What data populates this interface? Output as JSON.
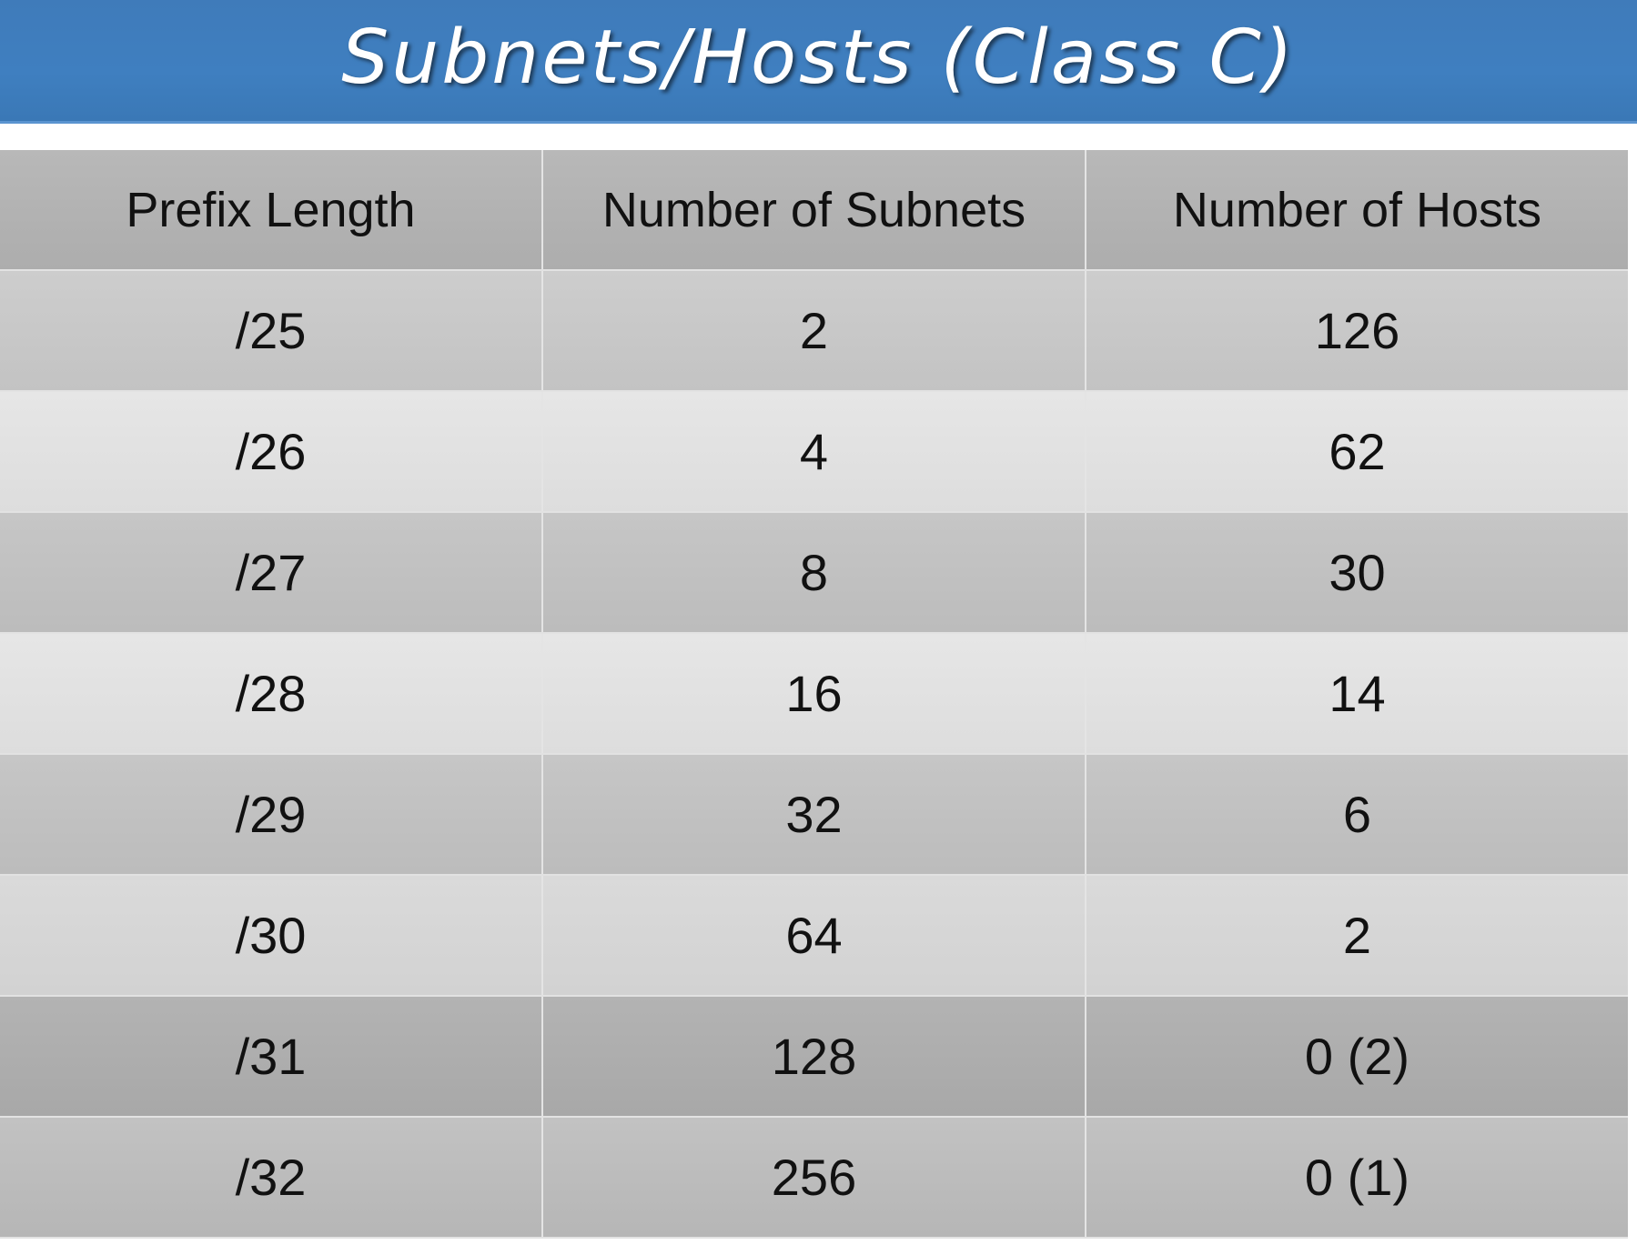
{
  "title": "Subnets/Hosts (Class C)",
  "table": {
    "headers": [
      "Prefix Length",
      "Number of Subnets",
      "Number of Hosts"
    ],
    "rows": [
      [
        "/25",
        "2",
        "126"
      ],
      [
        "/26",
        "4",
        "62"
      ],
      [
        "/27",
        "8",
        "30"
      ],
      [
        "/28",
        "16",
        "14"
      ],
      [
        "/29",
        "32",
        "6"
      ],
      [
        "/30",
        "64",
        "2"
      ],
      [
        "/31",
        "128",
        "0 (2)"
      ],
      [
        "/32",
        "256",
        "0 (1)"
      ]
    ]
  },
  "colors": {
    "title_bar": "#3f7fc0",
    "title_text": "#ffffff",
    "header_bg": "#b3b3b3"
  }
}
